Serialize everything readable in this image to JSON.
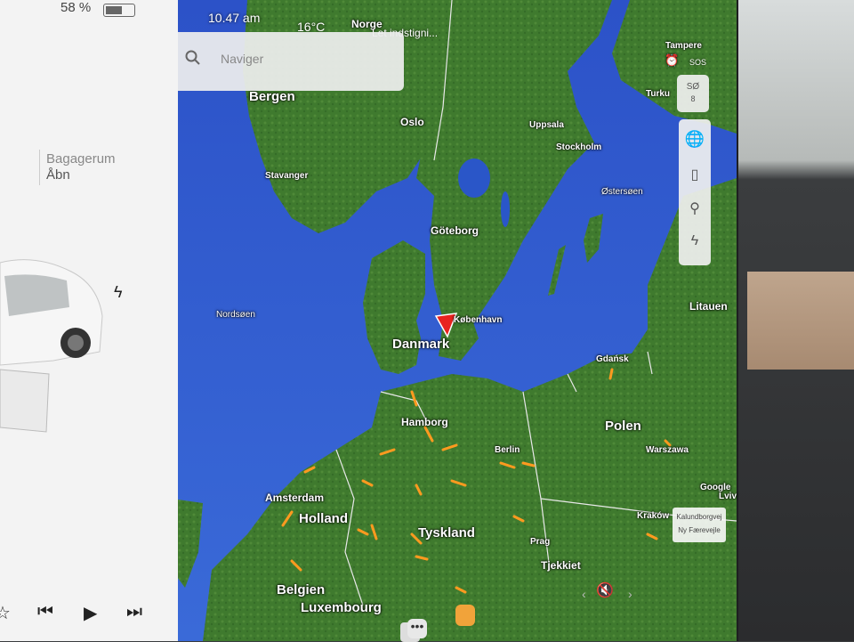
{
  "left_panel": {
    "battery_percent": "58 %",
    "trunk_label": "Bagagerum",
    "trunk_status": "Åbn"
  },
  "status_bar": {
    "time": "10.47 am",
    "temperature": "16°C",
    "notification": "Let indstigni..."
  },
  "search": {
    "placeholder": "Naviger"
  },
  "map": {
    "labels": {
      "norge": "Norge",
      "bergen": "Bergen",
      "oslo": "Oslo",
      "stavanger": "Stavanger",
      "uppsala": "Uppsala",
      "stockholm": "Stockholm",
      "turku": "Turku",
      "tampere": "Tampere",
      "ostersoen": "Østersøen",
      "goteborg": "Göteborg",
      "nordsoen": "Nordsøen",
      "kobenhavn": "København",
      "danmark": "Danmark",
      "litauen": "Litauen",
      "gdansk": "Gdańsk",
      "hamborg": "Hamborg",
      "polen": "Polen",
      "berlin": "Berlin",
      "warszawa": "Warszawa",
      "amsterdam": "Amsterdam",
      "holland": "Holland",
      "tyskland": "Tyskland",
      "krakow": "Kraków",
      "prag": "Prag",
      "tjekkiet": "Tjekkiet",
      "belgien": "Belgien",
      "luxembourg": "Luxembourg",
      "google": "Google",
      "lviv": "Lviv"
    },
    "attribution": {
      "line1": "Kalundborgvej",
      "line2": "Ny Færevejle"
    }
  },
  "controls": {
    "compass_text": "SØ",
    "compass_sub": "8",
    "sos_label": "SOS"
  },
  "colors": {
    "sea": "#2f5fd3",
    "land": "#3f7a2e",
    "traffic": "#ff9a1f",
    "nav_arrow": "#e8221f"
  }
}
